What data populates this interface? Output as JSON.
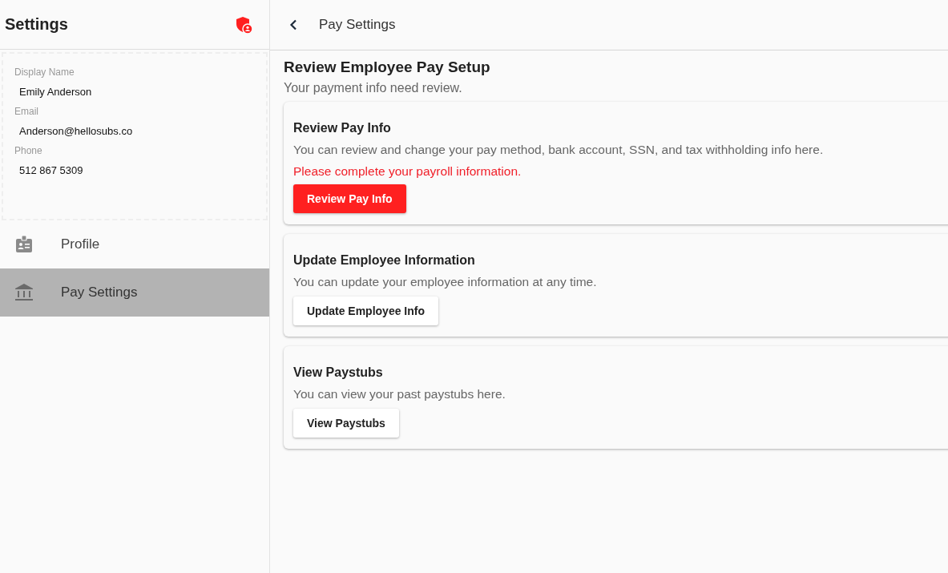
{
  "sidebar": {
    "title": "Settings",
    "profile": {
      "fields": [
        {
          "label": "Display Name",
          "value": "Emily Anderson"
        },
        {
          "label": "Email",
          "value": "Anderson@hellosubs.co"
        },
        {
          "label": "Phone",
          "value": "512 867 5309"
        }
      ]
    },
    "items": [
      {
        "label": "Profile",
        "kind": "badge",
        "selected": false
      },
      {
        "label": "Pay Settings",
        "kind": "bank",
        "selected": true
      }
    ]
  },
  "header": {
    "title": "Pay Settings"
  },
  "main": {
    "heading": "Review Employee Pay Setup",
    "subheading": "Your payment info need review.",
    "cards": [
      {
        "title": "Review Pay Info",
        "description": "You can review and change your pay method, bank account, SSN, and tax withholding info here.",
        "warning": "Please complete your payroll information.",
        "button": {
          "label": "Review Pay Info",
          "kind": "primary"
        }
      },
      {
        "title": "Update Employee Information",
        "description": "You can update your employee information at any time.",
        "button": {
          "label": "Update Employee Info",
          "kind": "default"
        }
      },
      {
        "title": "View Paystubs",
        "description": "You can view your past paystubs here.",
        "button": {
          "label": "View Paystubs",
          "kind": "default"
        }
      }
    ]
  }
}
